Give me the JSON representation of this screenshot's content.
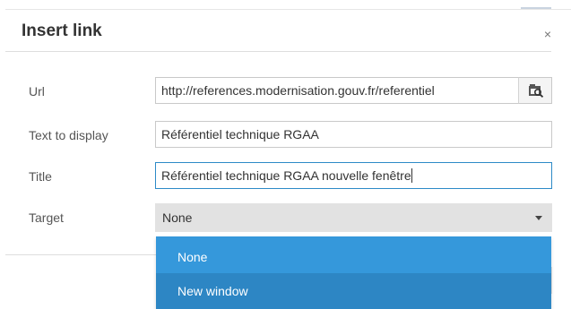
{
  "dialog": {
    "title": "Insert link",
    "close_glyph": "×"
  },
  "fields": {
    "url": {
      "label": "Url",
      "value": "http://references.modernisation.gouv.fr/referentiel",
      "browse_icon": "browse-icon"
    },
    "text_to_display": {
      "label": "Text to display",
      "value": "Référentiel technique RGAA"
    },
    "title": {
      "label": "Title",
      "value": "Référentiel technique RGAA nouvelle fenêtre"
    },
    "target": {
      "label": "Target",
      "selected": "None",
      "options": [
        "None",
        "New window"
      ]
    }
  },
  "colors": {
    "accent": "#3598db",
    "accent_hover": "#2d86c4",
    "focus_border": "#2d8ac7",
    "select_bg": "#e2e2e2"
  }
}
